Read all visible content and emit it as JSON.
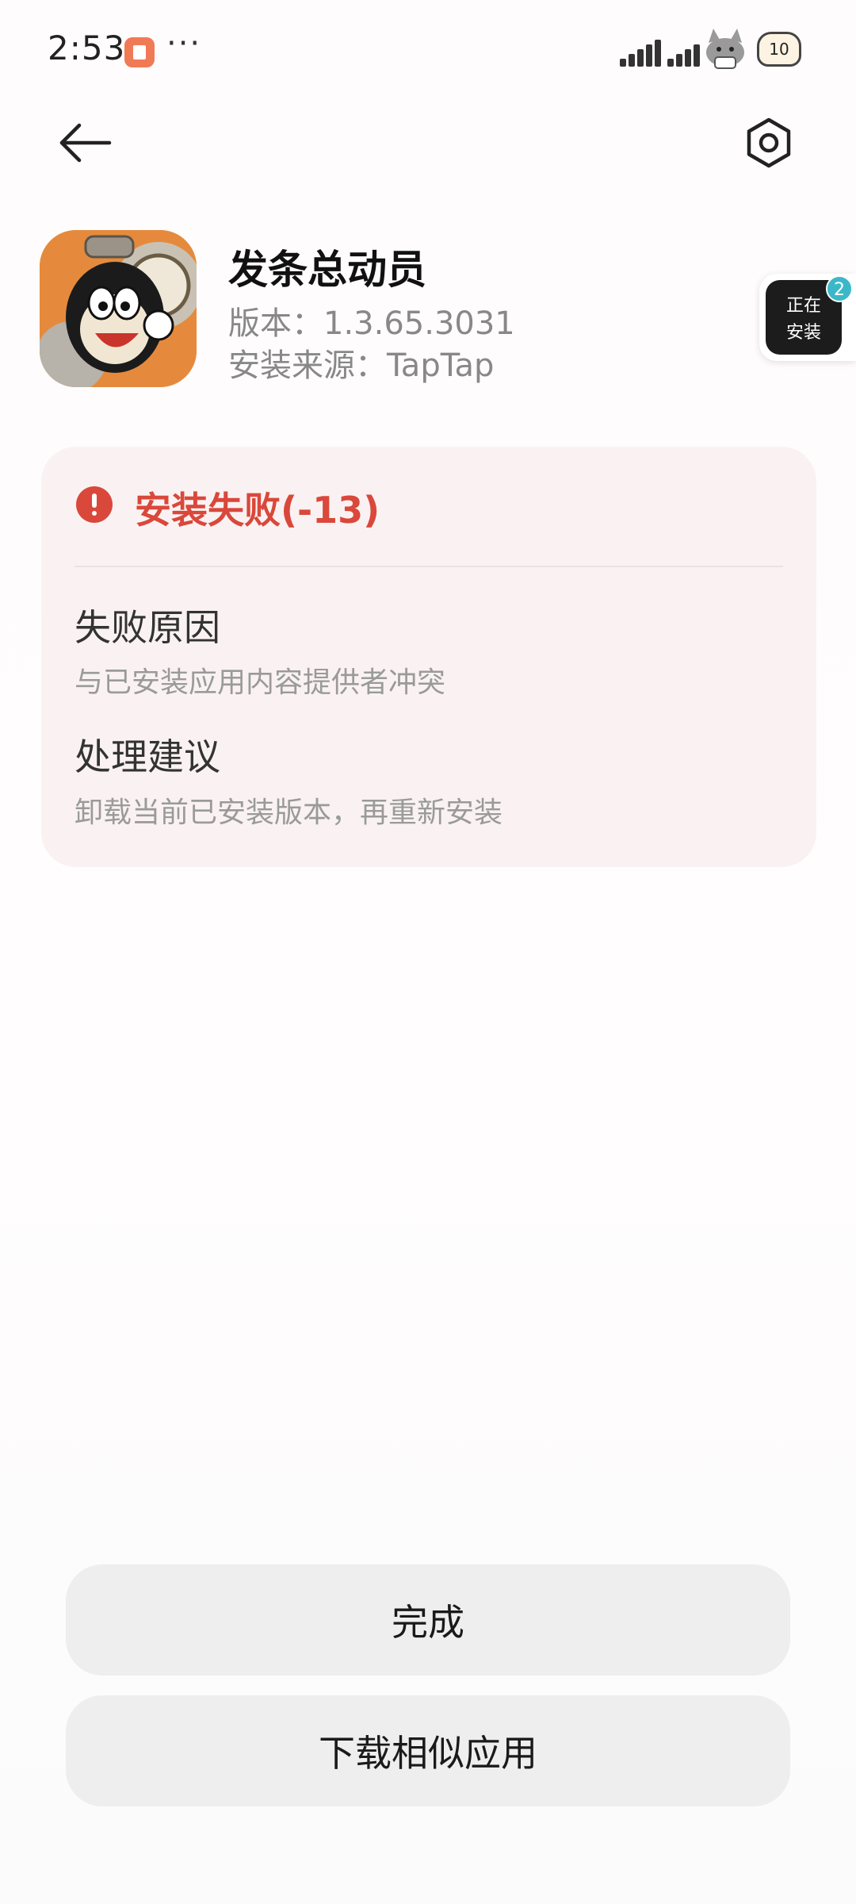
{
  "status_bar": {
    "time": "2:53",
    "more": "···",
    "battery": "10"
  },
  "app": {
    "name": "发条总动员",
    "version": "版本：1.3.65.3031",
    "source": "安装来源：TapTap"
  },
  "floating_install": {
    "line1": "正在",
    "line2": "安装",
    "badge": "2"
  },
  "failure": {
    "title": "安装失败(-13)",
    "reason_heading": "失败原因",
    "reason_text": "与已安装应用内容提供者冲突",
    "advice_heading": "处理建议",
    "advice_text": "卸载当前已安装版本，再重新安装"
  },
  "buttons": {
    "done": "完成",
    "download_similar": "下载相似应用"
  },
  "colors": {
    "error": "#d9483b",
    "card_bg": "#faf2f2",
    "button_bg": "#eeeeee",
    "badge": "#3bb8c8"
  },
  "icons": {
    "back": "arrow-left-icon",
    "settings": "settings-icon",
    "error": "exclamation-circle-icon"
  }
}
